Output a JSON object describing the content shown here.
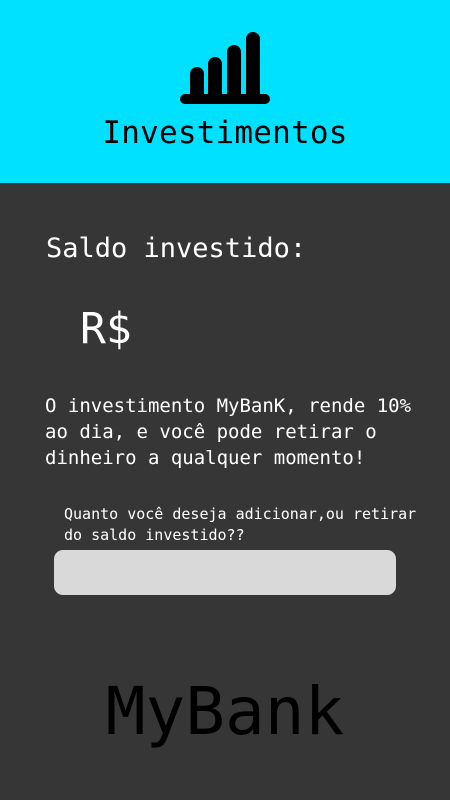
{
  "header": {
    "icon": "bar-chart-icon",
    "title": "Investimentos",
    "background_color": "#00E1FF"
  },
  "main": {
    "balance_label": "Saldo investido:",
    "currency_symbol": "R$",
    "description": "O investimento MyBanK, rende 10% ao dia, e você pode retirar o dinheiro a qualquer momento!",
    "question": "Quanto você deseja adicionar,ou retirar do saldo investido??",
    "amount_input": {
      "value": "",
      "placeholder": ""
    },
    "background_color": "#363636"
  },
  "footer": {
    "brand": "MyBank"
  }
}
